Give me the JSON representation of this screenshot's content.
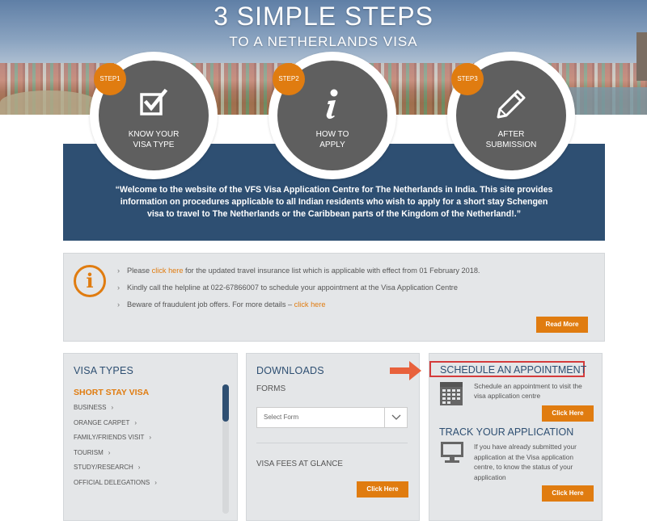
{
  "hero": {
    "title": "3 SIMPLE STEPS",
    "subtitle": "TO A NETHERLANDS VISA"
  },
  "steps": [
    {
      "badge": "STEP1",
      "label_line1": "KNOW YOUR",
      "label_line2": "VISA TYPE",
      "icon": "checkbox-icon"
    },
    {
      "badge": "STEP2",
      "label_line1": "HOW TO",
      "label_line2": "APPLY",
      "icon": "info-icon"
    },
    {
      "badge": "STEP3",
      "label_line1": "AFTER",
      "label_line2": "SUBMISSION",
      "icon": "pencil-icon"
    }
  ],
  "welcome": {
    "text": "“Welcome to the website of the VFS Visa Application Centre for The Netherlands in India. This site provides information on procedures applicable to all Indian residents who wish to apply for a short stay Schengen visa to travel to The Netherlands or the Caribbean parts of the Kingdom of the Netherland!.”"
  },
  "notice": {
    "items": [
      {
        "pre": "Please ",
        "link": "click here",
        "post": " for the updated travel insurance list which is applicable with effect from 01 February 2018."
      },
      {
        "pre": "Kindly call the helpline at 022-67866007 to schedule your appointment at the Visa Application Centre",
        "link": "",
        "post": ""
      },
      {
        "pre": "Beware of fraudulent job offers. For more details – ",
        "link": "click here",
        "post": ""
      }
    ],
    "read_more": "Read More"
  },
  "visa_types": {
    "title": "VISA TYPES",
    "heading": "SHORT STAY VISA",
    "items": [
      "BUSINESS",
      "ORANGE CARPET",
      "FAMILY/FRIENDS VISIT",
      "TOURISM",
      "STUDY/RESEARCH",
      "OFFICIAL DELEGATIONS"
    ]
  },
  "downloads": {
    "title": "DOWNLOADS",
    "forms_label": "FORMS",
    "select_placeholder": "Select Form",
    "fees_label": "VISA FEES AT GLANCE",
    "fees_button": "Click Here"
  },
  "schedule": {
    "title": "SCHEDULE AN APPOINTMENT",
    "desc": "Schedule an appointment to visit the visa application centre",
    "button": "Click Here",
    "track_title": "TRACK YOUR APPLICATION",
    "track_desc": "If you have already submitted your application at the Visa application centre, to know the status of your application",
    "track_button": "Click Here"
  },
  "colors": {
    "accent": "#e07c10",
    "navy": "#2e4f72",
    "highlight_border": "#d43b3b"
  }
}
